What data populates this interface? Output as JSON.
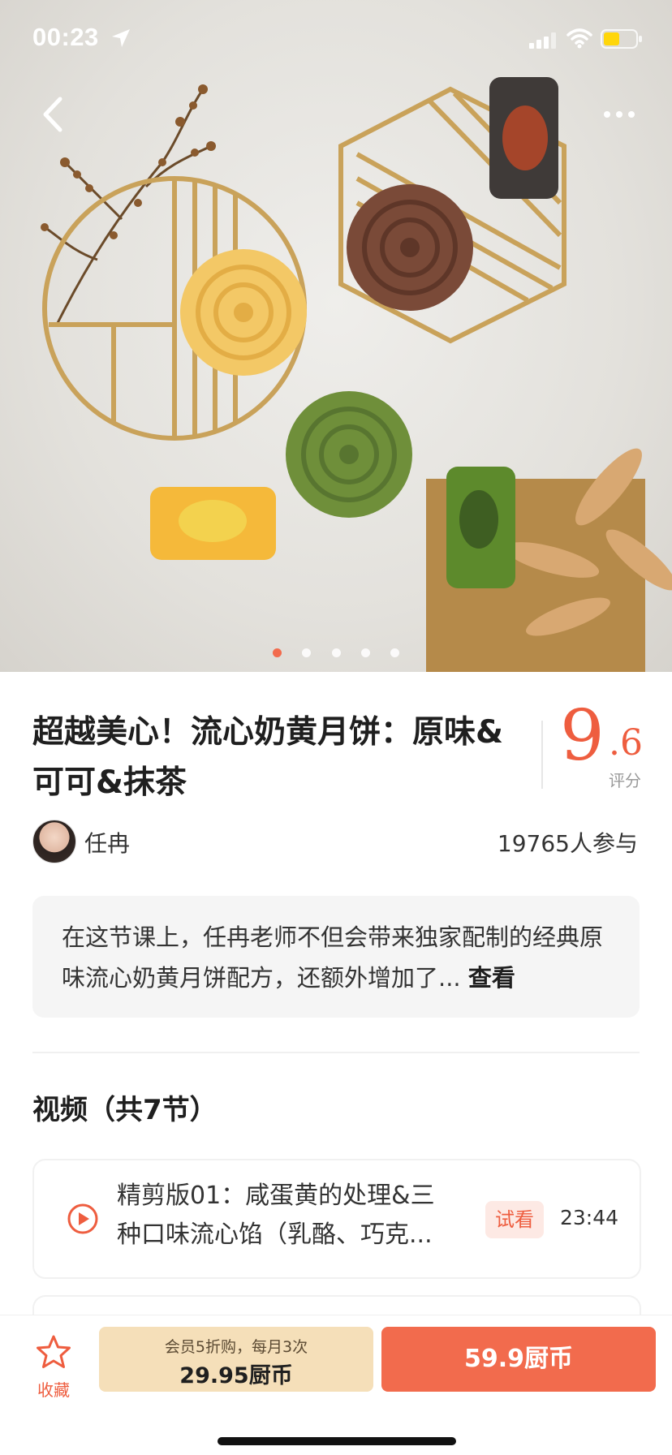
{
  "status_bar": {
    "time": "00:23"
  },
  "hero": {
    "image_dots_count": 5,
    "active_dot_index": 0
  },
  "course": {
    "title": "超越美心！流心奶黄月饼：原味&可可&抹茶",
    "score_int": "9",
    "score_dec": ".6",
    "score_label": "评分",
    "author": "任冉",
    "participants": "19765人参与",
    "description": "在这节课上，任冉老师不但会带来独家配制的经典原味流心奶黄月饼配方，还额外增加了...",
    "description_more": "查看"
  },
  "videos": {
    "section_title": "视频（共7节）",
    "items": [
      {
        "title": "精剪版01：咸蛋黄的处理&三种口味流心馅（乳酪、巧克...",
        "badge": "试看",
        "duration": "23:44"
      }
    ]
  },
  "bottom_bar": {
    "favorite_label": "收藏",
    "member_note": "会员5折购，每月3次",
    "member_price": "29.95厨币",
    "buy_label": "59.9厨币"
  },
  "colors": {
    "accent": "#f26b4d",
    "score": "#ee5d3f",
    "member_bg": "#f5dfb9"
  }
}
